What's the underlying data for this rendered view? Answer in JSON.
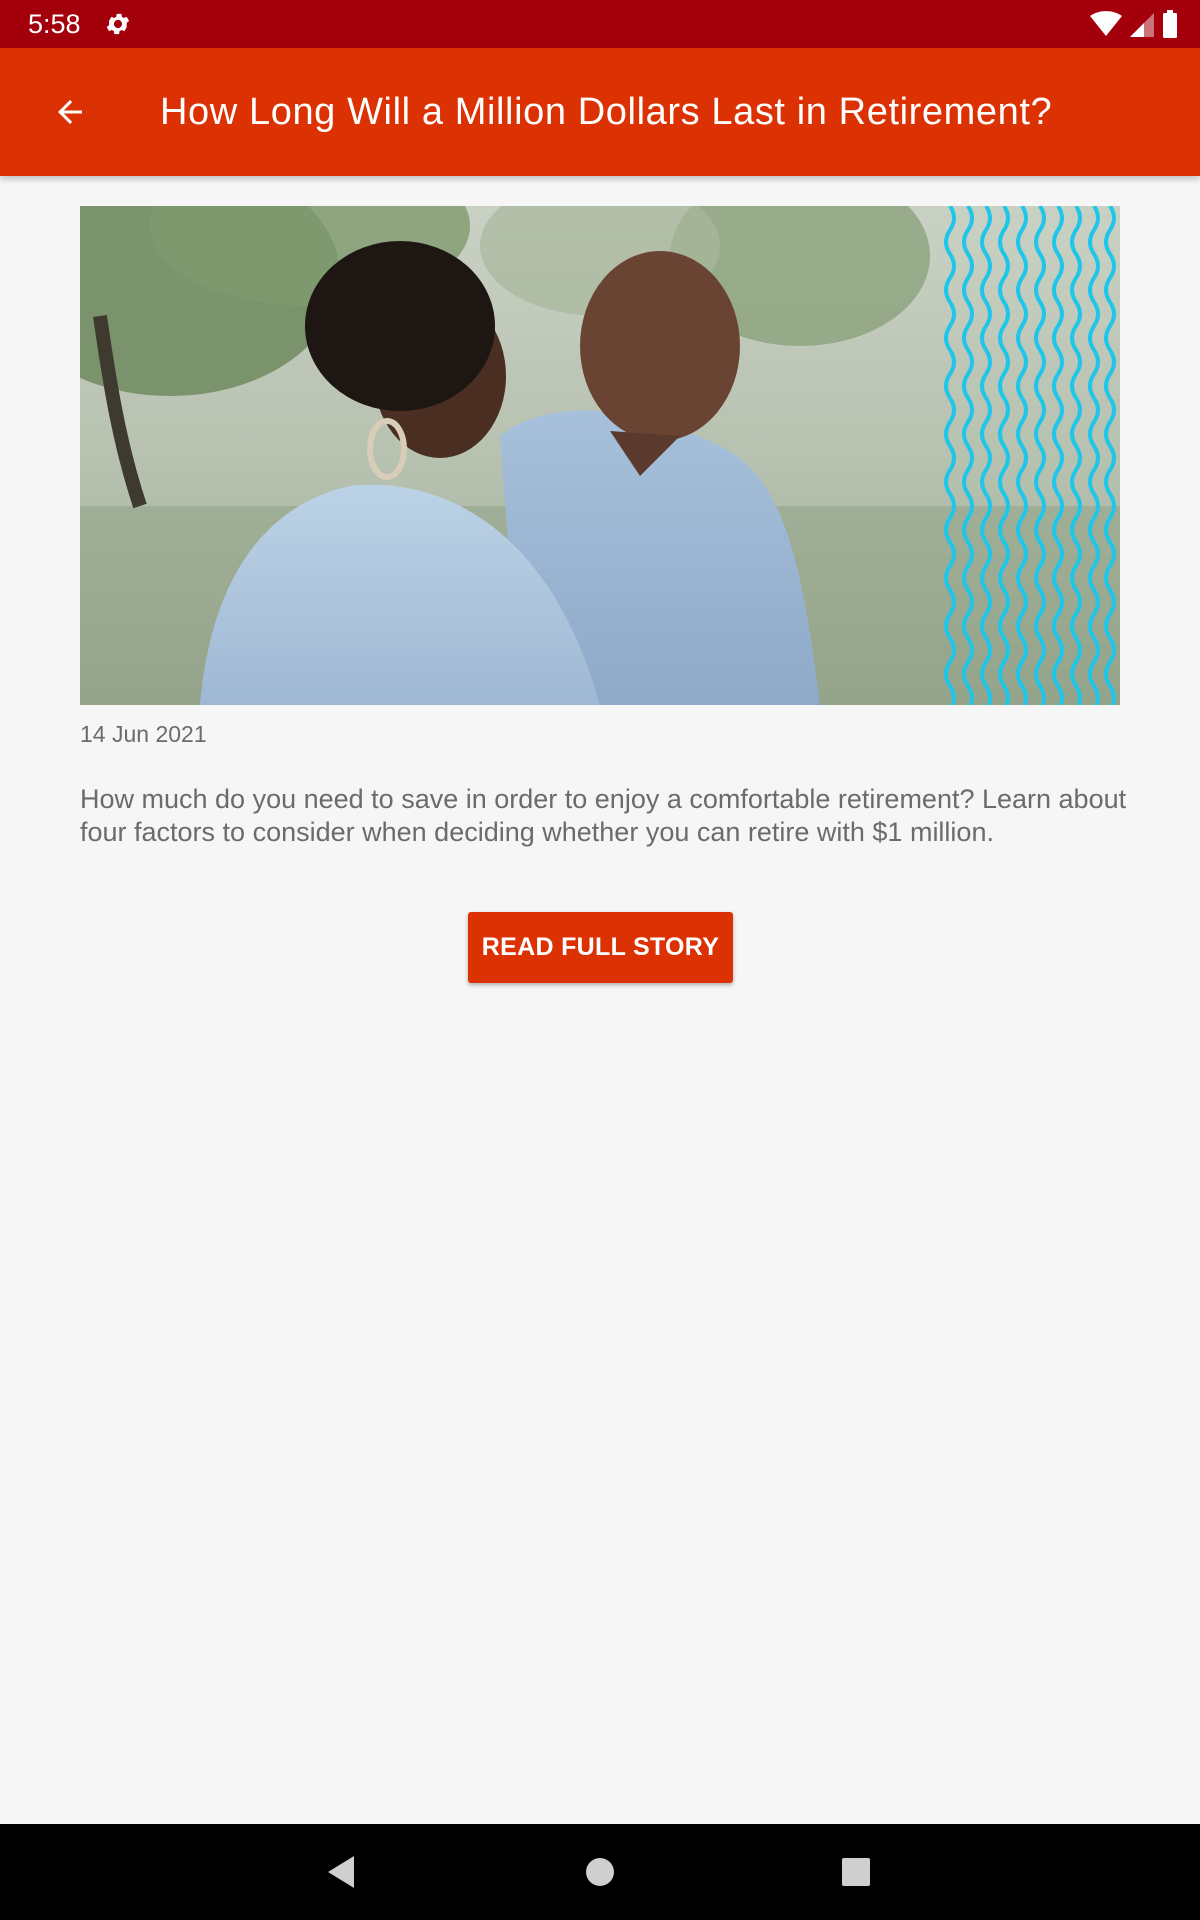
{
  "status_bar": {
    "time": "5:58",
    "icons": [
      "settings-icon",
      "wifi-icon",
      "cellular-signal-icon",
      "battery-icon"
    ]
  },
  "app_bar": {
    "back_icon": "arrow-back-icon",
    "title": "How Long Will a Million Dollars Last in Retirement?"
  },
  "article": {
    "hero_image": "photo-couple-smiling-outdoors",
    "date": "14 Jun 2021",
    "summary": "How much do you need to save in order to enjoy a comfortable retirement? Learn about four factors to consider when deciding whether you can retire with $1 million.",
    "cta_label": "READ FULL STORY"
  },
  "nav_bar": {
    "icons": [
      "nav-back-icon",
      "nav-home-icon",
      "nav-recents-icon"
    ]
  },
  "colors": {
    "status_bar": "#a3000c",
    "app_bar": "#dc3102",
    "accent": "#dc3102",
    "background": "#f6f6f6",
    "body_text": "#6b6b6b",
    "wave_accent": "#1ec6ea"
  }
}
